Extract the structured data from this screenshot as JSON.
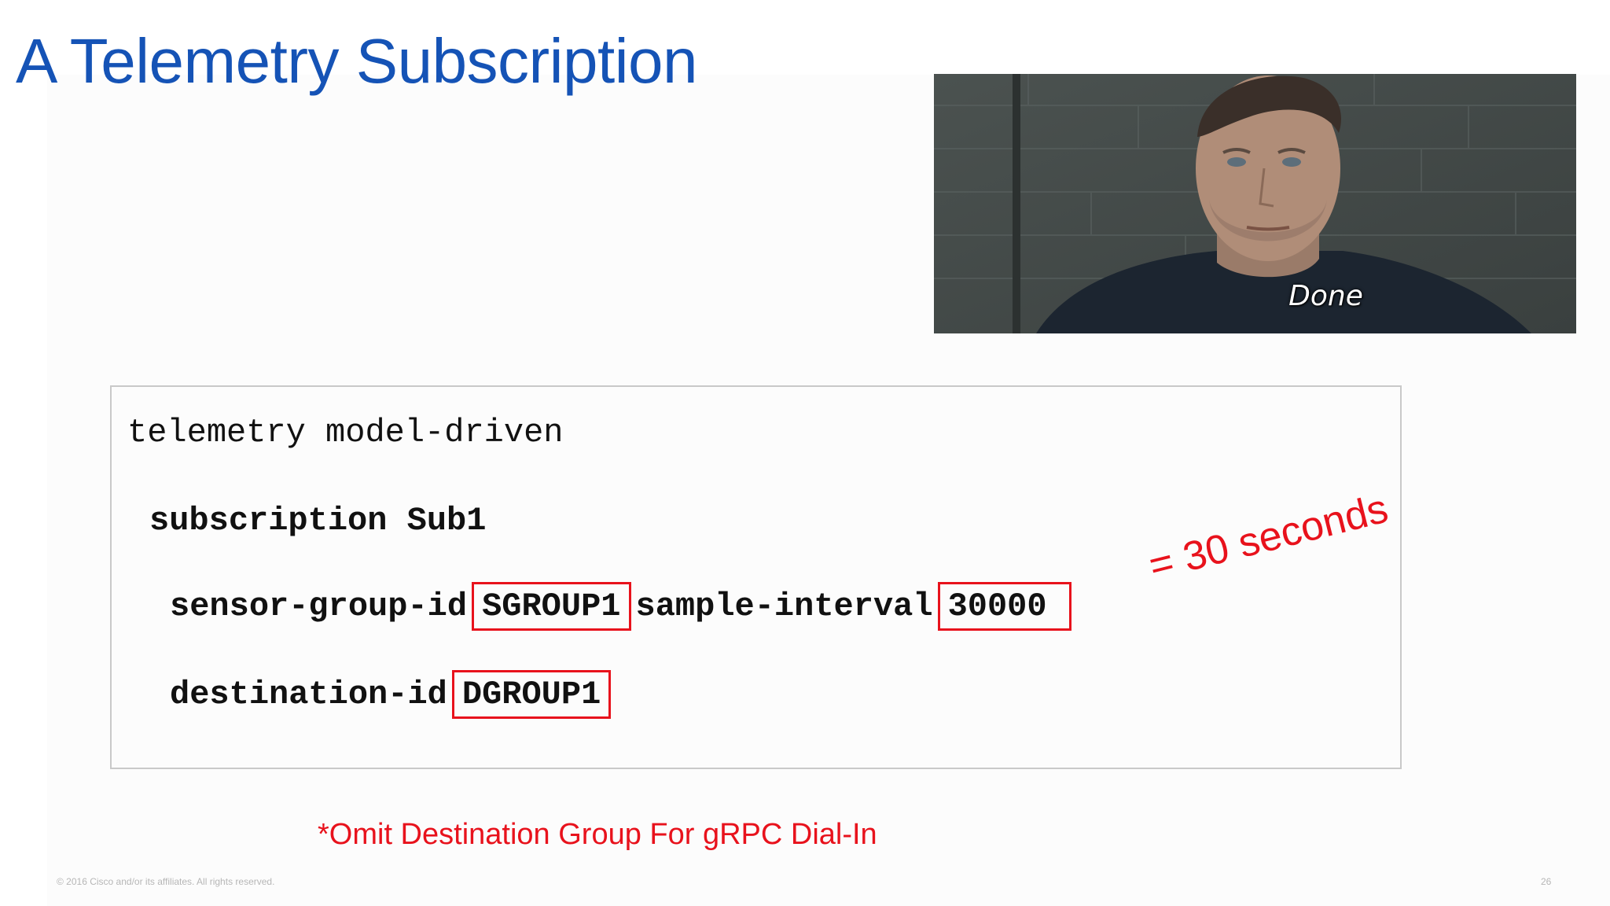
{
  "slide": {
    "title": "A Telemetry Subscription",
    "footer": "© 2016 Cisco and/or its affiliates. All rights reserved.",
    "page_number": "26"
  },
  "gif": {
    "caption": "Done"
  },
  "code": {
    "line1": "telemetry model-driven",
    "line2": "subscription Sub1",
    "line3_prefix": "sensor-group-id",
    "line3_sensor_group": "SGROUP1",
    "line3_middle": "sample-interval",
    "line3_interval": "30000",
    "line4_prefix": "destination-id",
    "line4_destination": "DGROUP1"
  },
  "annotation": "= 30 seconds",
  "note": "*Omit Destination Group For gRPC Dial-In",
  "colors": {
    "title": "#1553b6",
    "highlight": "#e8121c"
  }
}
